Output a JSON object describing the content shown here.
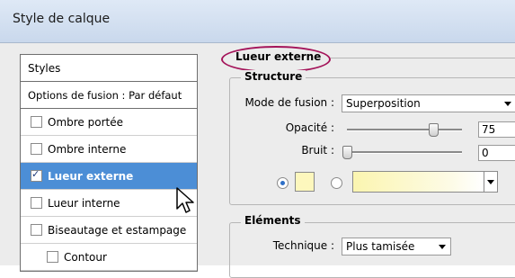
{
  "window": {
    "title": "Style de calque"
  },
  "styles_list": {
    "header": "Styles",
    "blend_options": "Options de fusion : Par défaut",
    "items": [
      {
        "label": "Ombre portée",
        "checked": false,
        "selected": false,
        "indent": false
      },
      {
        "label": "Ombre interne",
        "checked": false,
        "selected": false,
        "indent": false
      },
      {
        "label": "Lueur externe",
        "checked": true,
        "selected": true,
        "indent": false
      },
      {
        "label": "Lueur interne",
        "checked": false,
        "selected": false,
        "indent": false
      },
      {
        "label": "Biseautage et estampage",
        "checked": false,
        "selected": false,
        "indent": false
      },
      {
        "label": "Contour",
        "checked": false,
        "selected": false,
        "indent": true
      }
    ]
  },
  "panel": {
    "title": "Lueur externe",
    "structure": {
      "label": "Structure",
      "blend_mode_label": "Mode de fusion :",
      "blend_mode_value": "Superposition",
      "opacity_label": "Opacité :",
      "opacity_value": "75",
      "opacity_fraction": 0.75,
      "noise_label": "Bruit :",
      "noise_value": "0",
      "noise_fraction": 0.0,
      "color_mode": "solid",
      "swatch_color": "#fdf7bd"
    },
    "elements": {
      "label": "Eléments",
      "technique_label": "Technique :",
      "technique_value": "Plus tamisée"
    }
  },
  "colors": {
    "selection": "#4c8ed6",
    "highlight_ellipse": "#a4145a"
  }
}
